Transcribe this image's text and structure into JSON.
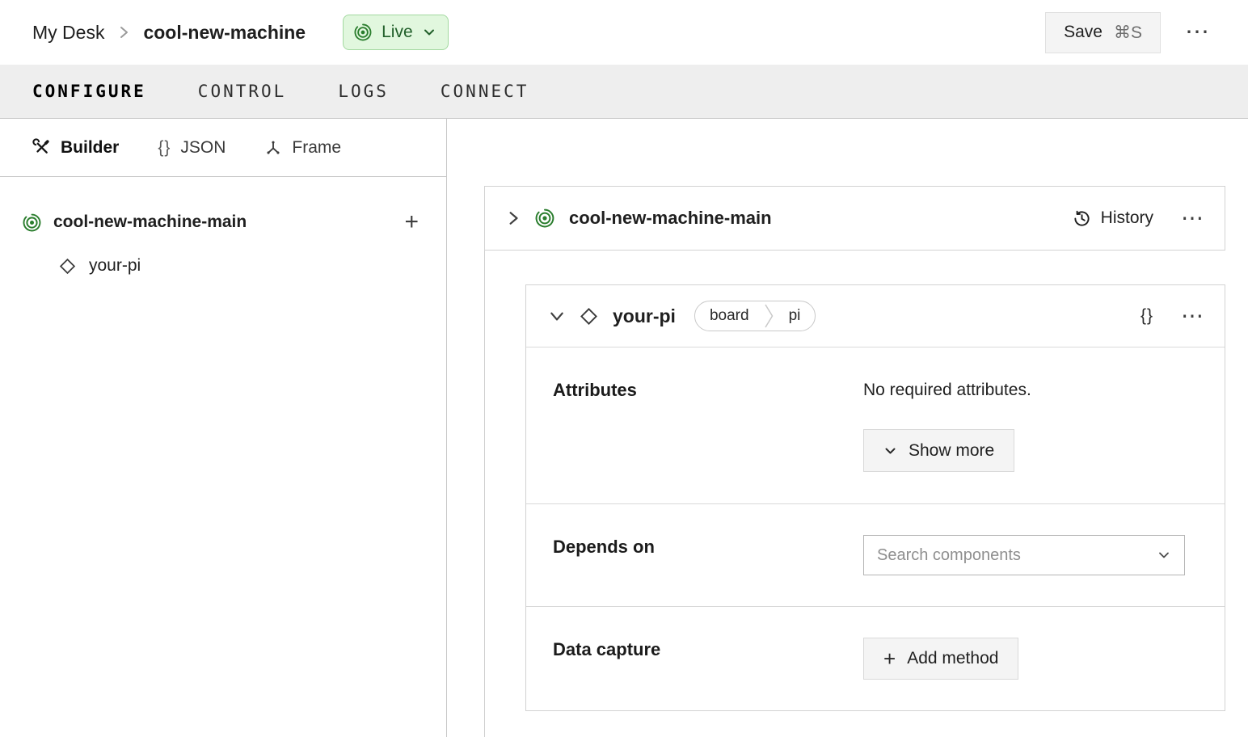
{
  "colors": {
    "accent_green": "#2a7d2d",
    "live_badge_bg": "#e1f7de",
    "live_badge_border": "#a3d9a0",
    "live_badge_text": "#215f2a",
    "tabbar_bg": "#eeeeee",
    "card_border": "#d2d2d2",
    "button_bg": "#f4f4f4"
  },
  "icons": {
    "ellipsis": "⋯",
    "braces": "{}",
    "plus": "+"
  },
  "header": {
    "breadcrumb": {
      "root": "My Desk",
      "current": "cool-new-machine"
    },
    "live_badge": {
      "label": "Live"
    },
    "save_button": {
      "label": "Save",
      "shortcut": "⌘S"
    }
  },
  "tabs": [
    {
      "label": "CONFIGURE",
      "active": true
    },
    {
      "label": "CONTROL",
      "active": false
    },
    {
      "label": "LOGS",
      "active": false
    },
    {
      "label": "CONNECT",
      "active": false
    }
  ],
  "sidebar": {
    "modes": [
      {
        "label": "Builder",
        "active": true
      },
      {
        "label": "JSON",
        "active": false
      },
      {
        "label": "Frame",
        "active": false
      }
    ],
    "tree": {
      "root_label": "cool-new-machine-main",
      "child_label": "your-pi"
    }
  },
  "main": {
    "machine_card": {
      "title": "cool-new-machine-main",
      "history_label": "History"
    },
    "component_card": {
      "title": "your-pi",
      "badges": [
        {
          "label": "board"
        },
        {
          "label": "pi"
        }
      ],
      "attributes": {
        "label": "Attributes",
        "empty_text": "No required attributes.",
        "show_more_label": "Show more"
      },
      "depends_on": {
        "label": "Depends on",
        "search_placeholder": "Search components"
      },
      "data_capture": {
        "label": "Data capture",
        "add_method_label": "Add method"
      }
    }
  }
}
